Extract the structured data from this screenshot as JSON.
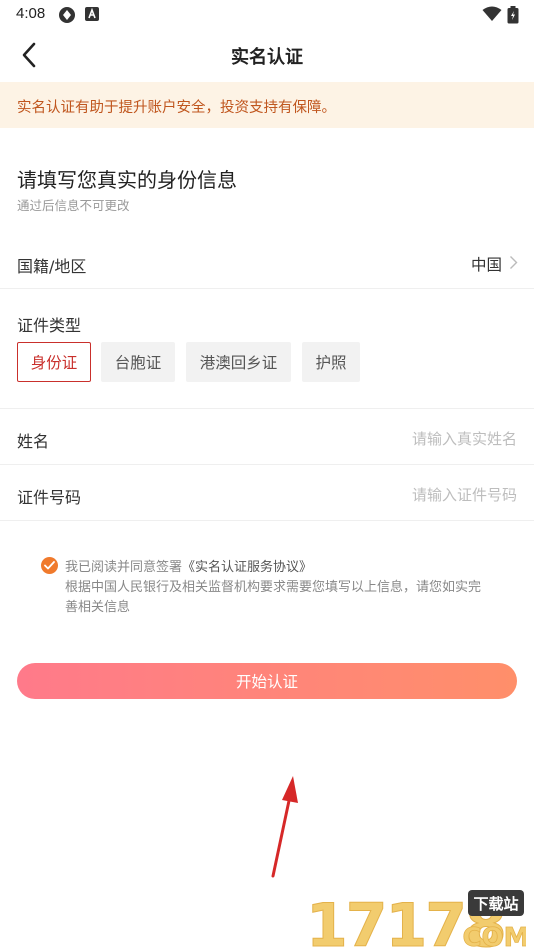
{
  "status_bar": {
    "time": "4:08"
  },
  "nav": {
    "title": "实名认证"
  },
  "notice": {
    "text": "实名认证有助于提升账户安全，投资支持有保障。"
  },
  "form": {
    "heading": "请填写您真实的身份信息",
    "subheading": "通过后信息不可更改",
    "nationality": {
      "label": "国籍/地区",
      "value": "中国"
    },
    "id_type": {
      "label": "证件类型",
      "options": [
        "身份证",
        "台胞证",
        "港澳回乡证",
        "护照"
      ],
      "selected": "身份证"
    },
    "name": {
      "label": "姓名",
      "placeholder": "请输入真实姓名"
    },
    "id_number": {
      "label": "证件号码",
      "placeholder": "请输入证件号码"
    }
  },
  "agreement": {
    "checked": true,
    "prefix": "我已阅读并同意签署",
    "link": "《实名认证服务协议》",
    "line2": "根据中国人民银行及相关监督机构要求需要您填写以上信息，请您如实完",
    "line3": "善相关信息"
  },
  "submit": {
    "label": "开始认证"
  },
  "watermark": {
    "number": "17178",
    "tag": "下载站",
    "domain": "COM"
  },
  "colors": {
    "accent_red": "#c9302c",
    "notice_bg": "#fdf3e5",
    "notice_text": "#c0561e",
    "check_orange": "#f07a2c",
    "button_gradient_start": "#ff7a8a",
    "button_gradient_end": "#ff8f6a",
    "annotation_arrow": "#d62828"
  },
  "icons": {
    "status": [
      "photo-icon",
      "app-a-icon",
      "wifi-icon",
      "battery-icon"
    ],
    "back": "chevron-left-icon",
    "chevron": "chevron-right-icon",
    "check": "check-icon",
    "annotation": "arrow-annotation"
  }
}
